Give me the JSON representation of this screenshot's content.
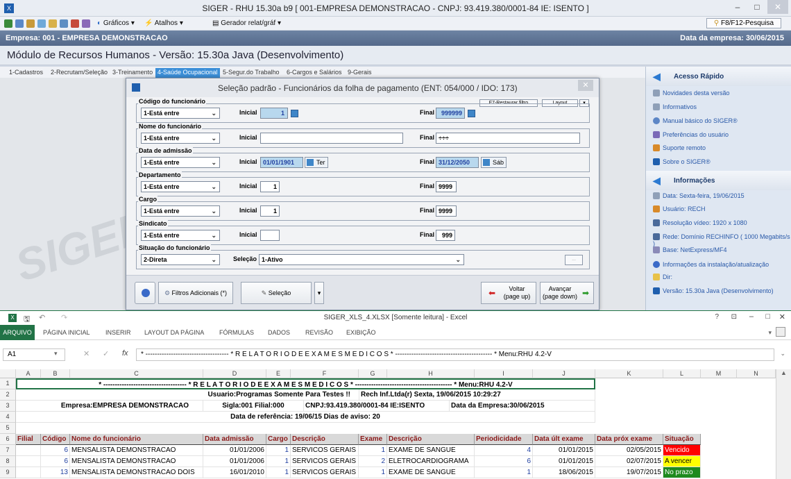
{
  "window": {
    "title": "SIGER - RHU 15.30a b9 [ 001-EMPRESA DEMONSTRACAO - CNPJ: 93.419.380/0001-84 IE: ISENTO ]"
  },
  "toolbar": {
    "graficos": "Gráficos",
    "atalhos": "Atalhos",
    "gerador": "Gerador relat/gráf",
    "f8_label": "F8/F12-Pesquisa"
  },
  "empresa": {
    "label": "Empresa: 001 - EMPRESA DEMONSTRACAO",
    "data": "Data da empresa: 30/06/2015"
  },
  "module_title": "Módulo de Recursos Humanos - Versão: 15.30a Java (Desenvolvimento)",
  "menu": [
    "1-Cadastros",
    "2-Recrutam/Seleção",
    "3-Treinamento",
    "4-Saúde Ocupacional",
    "5-Segur.do Trabalho",
    "6-Cargos e Salários",
    "9-Gerais"
  ],
  "watermark": "SIGER",
  "side": {
    "acesso_title": "Acesso Rápido",
    "acesso_items": [
      "Novidades desta versão",
      "Informativos",
      "Manual básico do SIGER®",
      "Preferências do usuário",
      "Suporte remoto",
      "Sobre o SIGER®"
    ],
    "info_title": "Informações",
    "info_items": [
      "Data: Sexta-feira, 19/06/2015",
      "Usuário: RECH",
      "Resolução vídeo: 1920 x 1080",
      "Rede: Domínio RECHINFO ( 1000 Megabits/s )",
      "Base: NetExpress/MF4",
      "Informações da instalação/atualização",
      "Dir:",
      "Versão: 15.30a Java (Desenvolvimento)"
    ]
  },
  "dialog": {
    "title": "Seleção padrão - Funcionários da folha de pagamento (ENT: 054/000 / IDO: 173)",
    "restore": "F7-Restaurar filtro",
    "layout": "Layout",
    "inicial": "Inicial",
    "final": "Final",
    "selecao_label": "Seleção",
    "groups": [
      {
        "label": "Código do funcionário",
        "op": "1-Está entre",
        "ini": "1",
        "fin": "999999"
      },
      {
        "label": "Nome do funcionário",
        "op": "1-Está entre",
        "ini": "",
        "fin": "÷÷÷"
      },
      {
        "label": "Data de admissão",
        "op": "1-Está entre",
        "ini": "01/01/1901",
        "ini_dow": "Ter",
        "fin": "31/12/2050",
        "fin_dow": "Sáb"
      },
      {
        "label": "Departamento",
        "op": "1-Está entre",
        "ini": "1",
        "fin": "9999"
      },
      {
        "label": "Cargo",
        "op": "1-Está entre",
        "ini": "1",
        "fin": "9999"
      },
      {
        "label": "Sindicato",
        "op": "1-Está entre",
        "ini": "",
        "fin": "999"
      },
      {
        "label": "Situação do funcionário",
        "op": "2-Direta",
        "sel": "1-Ativo"
      }
    ],
    "buttons": {
      "filtros": "Filtros Adicionais (*)",
      "selecao": "Seleção",
      "voltar": "Voltar",
      "voltar_sub": "(page up)",
      "avancar": "Avançar",
      "avancar_sub": "(page down)",
      "ellipsis": "..."
    }
  },
  "excel": {
    "title": "SIGER_XLS_4.XLSX  [Somente leitura] - Excel",
    "tabs": [
      "ARQUIVO",
      "PÁGINA INICIAL",
      "INSERIR",
      "LAYOUT DA PÁGINA",
      "FÓRMULAS",
      "DADOS",
      "REVISÃO",
      "EXIBIÇÃO"
    ],
    "help": "?",
    "namebox": "A1",
    "formula": "* ------------------------------------ * R E L A T O R I O   D E   E X A M E S   M E D I C O S * ------------------------------------------ * Menu:RHU 4.2-V",
    "columns": [
      "A",
      "B",
      "C",
      "D",
      "E",
      "F",
      "G",
      "H",
      "I",
      "J",
      "K",
      "L",
      "M",
      "N"
    ],
    "row_numbers": [
      "1",
      "2",
      "3",
      "4",
      "5",
      "6",
      "7",
      "8",
      "9"
    ],
    "r1": "* ------------------------------------ * R E L A T O R I O   D E   E X A M E S   M E D I C O S * ------------------------------------------ * Menu:RHU 4.2-V",
    "r2a": "Usuario:Programas Somente Para Testes !!",
    "r2b": "Rech Inf.Ltda(r)    Sexta, 19/06/2015 10:29:27",
    "r3a": "Empresa:EMPRESA DEMONSTRACAO",
    "r3b": "Sigla:001 Filial:000",
    "r3c": "CNPJ:93.419.380/0001-84 IE:ISENTO",
    "r3d": "Data da Empresa:30/06/2015",
    "r4": "Data de referência: 19/06/15  Dias de aviso:  20",
    "headers": [
      "Filial",
      "Código",
      "Nome do funcionário",
      "Data admissão",
      "Cargo",
      "Descrição",
      "Exame",
      "Descrição",
      "Periodicidade",
      "Data últ exame",
      "Data próx exame",
      "Situação"
    ],
    "rows": [
      {
        "codigo": "6",
        "nome": "MENSALISTA DEMONSTRACAO",
        "adm": "01/01/2006",
        "cargo": "1",
        "desc": "SERVICOS GERAIS",
        "exame": "1",
        "exdesc": "EXAME DE SANGUE",
        "period": "4",
        "ult": "01/01/2015",
        "prox": "02/05/2015",
        "sit": "Vencido",
        "color": "#ff0000"
      },
      {
        "codigo": "6",
        "nome": "MENSALISTA DEMONSTRACAO",
        "adm": "01/01/2006",
        "cargo": "1",
        "desc": "SERVICOS GERAIS",
        "exame": "2",
        "exdesc": "ELETROCARDIOGRAMA",
        "period": "6",
        "ult": "01/01/2015",
        "prox": "02/07/2015",
        "sit": "A vencer",
        "color": "#ffff00"
      },
      {
        "codigo": "13",
        "nome": "MENSALISTA DEMONSTRACAO DOIS",
        "adm": "16/01/2010",
        "cargo": "1",
        "desc": "SERVICOS GERAIS",
        "exame": "1",
        "exdesc": "EXAME DE SANGUE",
        "period": "1",
        "ult": "18/06/2015",
        "prox": "19/07/2015",
        "sit": "No prazo",
        "color": "#1e8a1e"
      }
    ]
  }
}
